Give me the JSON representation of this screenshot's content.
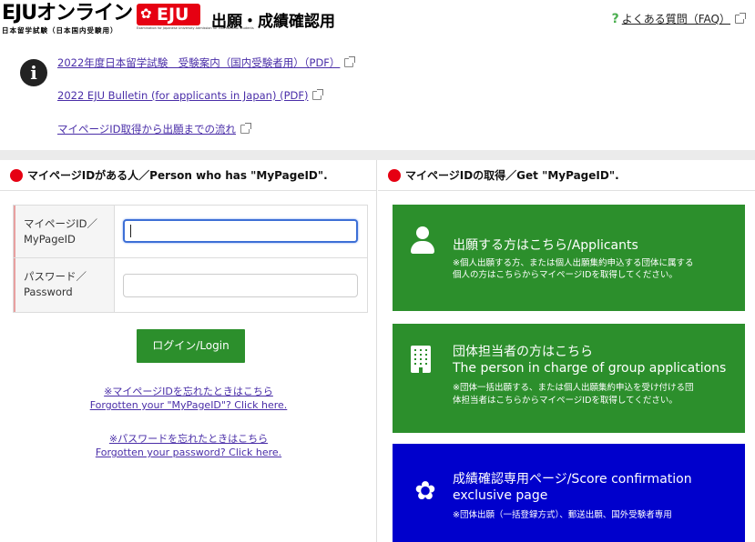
{
  "header": {
    "logo_main": "EJUオンライン",
    "logo_badge": "EJU",
    "logo_sub": "日本留学試験（日本国内受験用）",
    "logo_tiny": "Examination for Japanese University Admission for International Students",
    "page_title": "出願・成績確認用",
    "faq_label": "よくある質問（FAQ）"
  },
  "info": {
    "links": [
      "2022年度日本留学試験　受験案内（国内受験者用）（PDF）",
      "2022 EJU Bulletin (for applicants in Japan) (PDF)",
      "マイページID取得から出願までの流れ"
    ]
  },
  "login_section": {
    "heading": "マイページIDがある人／Person who has \"MyPageID\".",
    "id_label_1": "マイページID／",
    "id_label_2": "MyPageID",
    "pw_label_1": "パスワード／",
    "pw_label_2": "Password",
    "id_value": "",
    "pw_value": "",
    "login_button": "ログイン/Login",
    "forgot_id_jp": "※マイページIDを忘れたときはこちら",
    "forgot_id_en": "Forgotten your \"MyPageID\"? Click here.",
    "forgot_pw_jp": "※パスワードを忘れたときはこちら",
    "forgot_pw_en": "Forgotten your password? Click here."
  },
  "get_section": {
    "heading": "マイページIDの取得／Get \"MyPageID\".",
    "cards": [
      {
        "title": "出願する方はこちら/Applicants",
        "note_1": "※個人出願する方、または個人出願集約申込する団体に属する",
        "note_2": "個人の方はこちらからマイページIDを取得してください。",
        "color": "#2c8f2c"
      },
      {
        "title_1": "団体担当者の方はこちら",
        "title_2": "The person in charge of group applications",
        "note_1": "※団体一括出願する、または個人出願集約申込を受け付ける団",
        "note_2": "体担当者はこちらからマイページIDを取得してください。",
        "color": "#2c8f2c"
      },
      {
        "title_1": "成績確認専用ページ/Score confirmation",
        "title_2": "exclusive page",
        "note_1": "※団体出願（一括登録方式）、郵送出願、国外受験者専用",
        "color": "#0000cc"
      }
    ]
  },
  "colors": {
    "accent_red": "#e60012",
    "button_green": "#2c8f2c",
    "score_blue": "#0000cc",
    "link_purple": "#4a2ea8"
  },
  "icons": [
    "info-icon",
    "external-link-icon",
    "person-icon",
    "building-icon",
    "flower-icon",
    "faq-question-icon"
  ]
}
